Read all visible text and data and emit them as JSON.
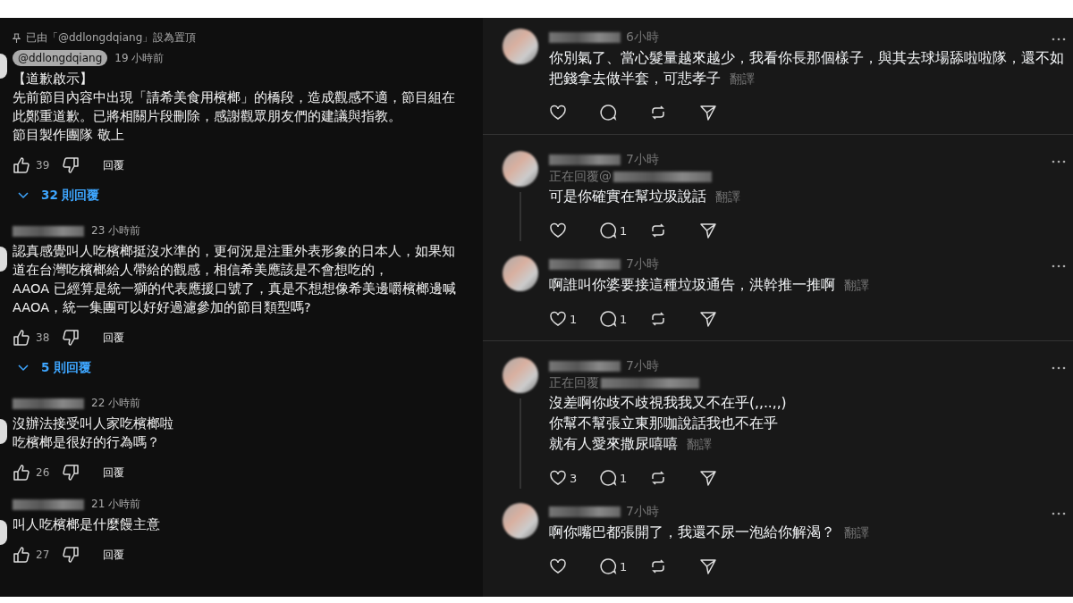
{
  "youtube": {
    "pinned_note": "已由「@ddlongdqiang」設為置頂",
    "comments": [
      {
        "author": "@ddlongdqiang",
        "time": "19 小時前",
        "lines": [
          "【道歉啟示】",
          "先前節目內容中出現「請希美食用檳榔」的橋段，造成觀感不適，節目組在此鄭重道歉。已將相關片段刪除，感謝觀眾朋友們的建議與指教。",
          "節目製作團隊 敬上"
        ],
        "likes": "39",
        "reply_label": "回覆",
        "replies": "32 則回覆"
      },
      {
        "time": "23 小時前",
        "lines": [
          "認真感覺叫人吃檳榔挺沒水準的，更何況是注重外表形象的日本人，如果知道在台灣吃檳榔給人帶給的觀感，相信希美應該是不會想吃的，",
          "AAOA 已經算是統一獅的代表應援口號了，真是不想想像希美邊嚼檳榔邊喊AAOA，統一集團可以好好過濾參加的節目類型嗎?"
        ],
        "likes": "38",
        "reply_label": "回覆",
        "replies": "5 則回覆"
      },
      {
        "time": "22 小時前",
        "lines": [
          "沒辦法接受叫人家吃檳榔啦",
          "吃檳榔是很好的行為嗎？"
        ],
        "likes": "26",
        "reply_label": "回覆"
      },
      {
        "time": "21 小時前",
        "lines": [
          "叫人吃檳榔是什麼饅主意"
        ],
        "likes": "27",
        "reply_label": "回覆"
      }
    ]
  },
  "threads": {
    "posts": [
      {
        "time": "6小時",
        "lines": [
          "你別氣了、當心髮量越來越少，我看你長那個樣子，與其去球場舔啦啦隊，還不如把錢拿去做半套，可悲孝子"
        ],
        "translate": "翻譯",
        "divider": true
      },
      {
        "time": "7小時",
        "replying_to": "正在回覆@",
        "lines": [
          "可是你確實在幫垃圾說話"
        ],
        "translate": "翻譯",
        "replies": "1",
        "divider": false
      },
      {
        "time": "7小時",
        "lines": [
          "啊誰叫你婆要接這種垃圾通告，洪幹推一推啊"
        ],
        "translate": "翻譯",
        "likes": "1",
        "replies": "1",
        "divider": true
      },
      {
        "time": "7小時",
        "replying_to": "正在回覆",
        "lines": [
          "沒差啊你歧不歧視我我又不在乎(,,..,,)",
          "你幫不幫張立東那咖說話我也不在乎",
          "就有人愛來撒尿嘻嘻"
        ],
        "translate": "翻譯",
        "likes": "3",
        "replies": "1",
        "divider": false
      },
      {
        "time": "7小時",
        "lines": [
          "啊你嘴巴都張開了，我還不尿一泡給你解渴？"
        ],
        "translate": "翻譯",
        "replies": "1",
        "divider": false
      }
    ]
  }
}
